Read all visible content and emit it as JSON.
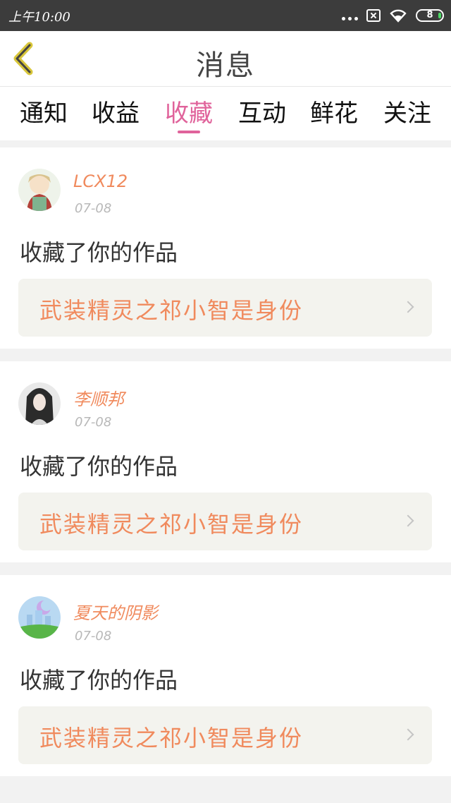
{
  "status_bar": {
    "time": "上午10:00",
    "battery": "8",
    "icons": [
      "more-dots-icon",
      "sim-icon",
      "wifi-icon",
      "battery-icon"
    ]
  },
  "header": {
    "title": "消息",
    "back_icon": "chevron-left-icon"
  },
  "tabs": [
    {
      "label": "通知",
      "active": false
    },
    {
      "label": "收益",
      "active": false
    },
    {
      "label": "收藏",
      "active": true
    },
    {
      "label": "互动",
      "active": false
    },
    {
      "label": "鲜花",
      "active": false
    },
    {
      "label": "关注",
      "active": false
    }
  ],
  "messages": [
    {
      "username": "LCX12",
      "date": "07-08",
      "action": "收藏了你的作品",
      "work_title": "武装精灵之祁小智是身份"
    },
    {
      "username": "李顺邦",
      "date": "07-08",
      "action": "收藏了你的作品",
      "work_title": "武装精灵之祁小智是身份"
    },
    {
      "username": "夏天的阴影",
      "date": "07-08",
      "action": "收藏了你的作品",
      "work_title": "武装精灵之祁小智是身份"
    }
  ],
  "colors": {
    "accent": "#e0639b",
    "username": "#f08a5d",
    "status_bar": "#3c3c3c"
  }
}
